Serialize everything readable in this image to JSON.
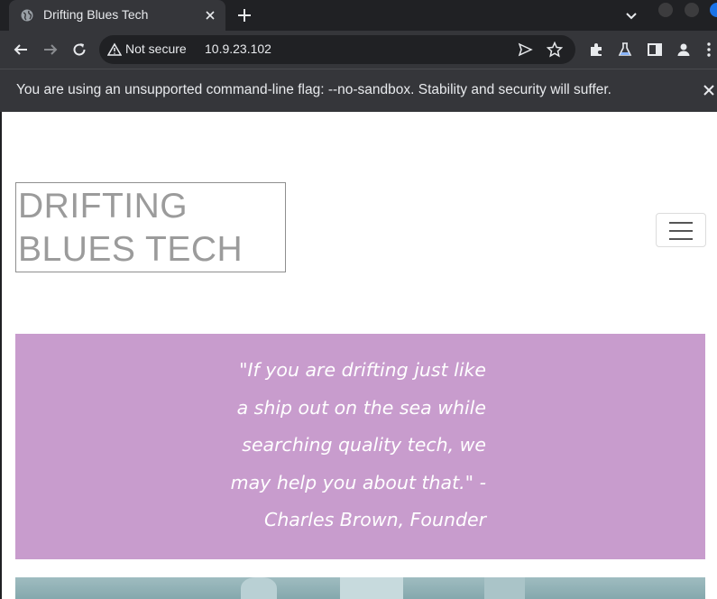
{
  "browser": {
    "tab": {
      "title": "Drifting Blues Tech",
      "favicon": "globe-icon"
    },
    "address_bar": {
      "security_label": "Not secure",
      "url": "10.9.23.102"
    },
    "infobar": {
      "message": "You are using an unsupported command-line flag: --no-sandbox. Stability and security will suffer."
    }
  },
  "page": {
    "brand": "DRIFTING BLUES TECH",
    "quote": "\"If you are drifting just like a ship out on the sea while searching quality tech, we may help you about that.\" - Charles Brown, Founder"
  },
  "colors": {
    "quote_background": "#c89ccd",
    "brand_text": "#9b9b9b",
    "chrome_dark": "#202124",
    "chrome_toolbar": "#35363a"
  }
}
